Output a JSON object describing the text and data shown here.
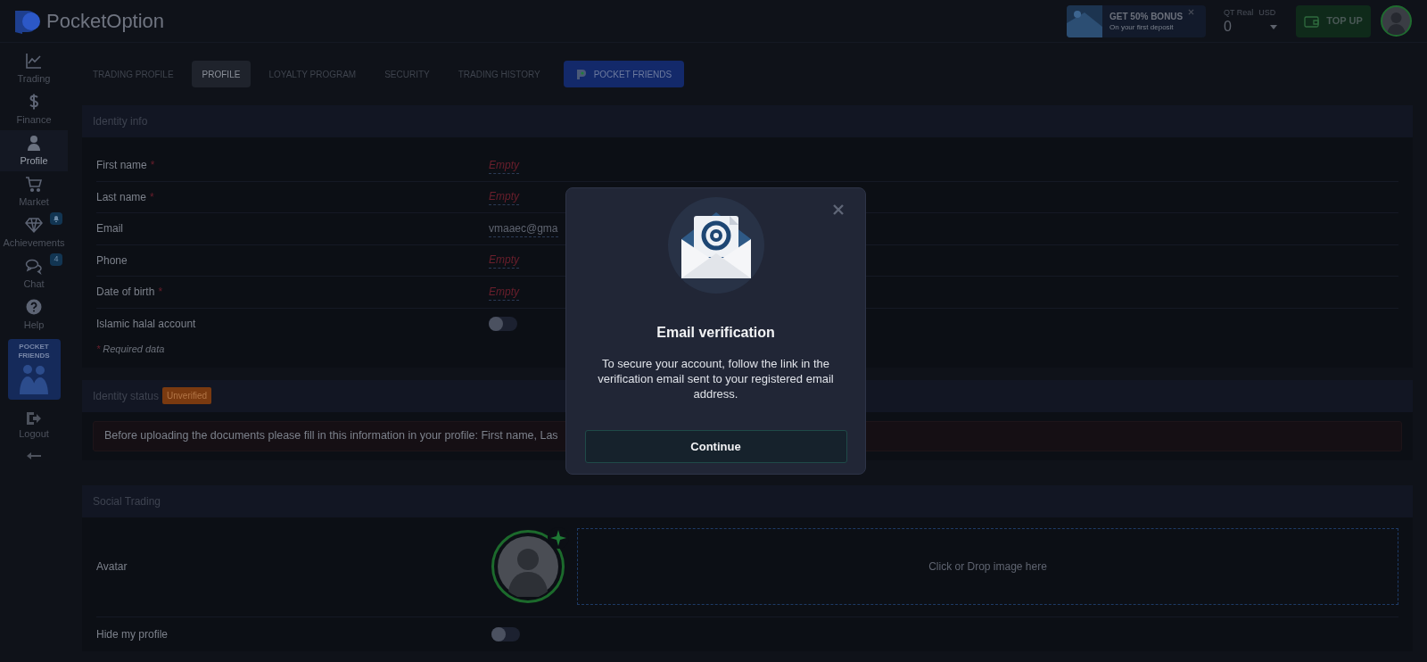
{
  "header": {
    "logo": "**Pocket**Option",
    "bonus": {
      "title": "GET 50% BONUS",
      "subtitle": "On your first deposit"
    },
    "account": {
      "label": "QT Real",
      "currency": "USD",
      "balance": "0"
    },
    "top_up": "TOP UP"
  },
  "sidebar": [
    {
      "label": "Trading",
      "selected": false,
      "kind": "plain"
    },
    {
      "label": "Finance",
      "selected": false,
      "kind": "plain"
    },
    {
      "label": "Profile",
      "selected": true,
      "kind": "plain"
    },
    {
      "label": "Market",
      "selected": false,
      "kind": "plain"
    },
    {
      "label": "Achievements",
      "selected": false,
      "kind": "bell"
    },
    {
      "label": "Chat",
      "selected": false,
      "kind": "count",
      "badge": "4"
    },
    {
      "label": "Help",
      "selected": false,
      "kind": "plain"
    }
  ],
  "promo_card": {
    "title": "POCKET FRIENDS"
  },
  "logout": "Logout",
  "tabs": [
    {
      "label": "TRADING PROFILE",
      "selected": false,
      "kind": "plain"
    },
    {
      "label": "PROFILE",
      "selected": true,
      "kind": "plain"
    },
    {
      "label": "LOYALTY PROGRAM",
      "selected": false,
      "kind": "plain"
    },
    {
      "label": "SECURITY",
      "selected": false,
      "kind": "plain"
    },
    {
      "label": "TRADING HISTORY",
      "selected": false,
      "kind": "plain"
    },
    {
      "label": "POCKET FRIENDS",
      "selected": false,
      "kind": "featured"
    }
  ],
  "identity_info": {
    "title": "Identity info",
    "required_mark": "*",
    "rows": [
      {
        "kind": "text",
        "label": "First name",
        "required": true,
        "value": "Empty",
        "empty": true
      },
      {
        "kind": "text",
        "label": "Last name",
        "required": true,
        "value": "Empty",
        "empty": true
      },
      {
        "kind": "text",
        "label": "Email",
        "required": false,
        "value": "vmaaec@gma",
        "empty": false
      },
      {
        "kind": "text",
        "label": "Phone",
        "required": false,
        "value": "Empty",
        "empty": true
      },
      {
        "kind": "text",
        "label": "Date of birth",
        "required": true,
        "value": "Empty",
        "empty": true
      },
      {
        "kind": "toggle",
        "label": "Islamic halal account",
        "required": false,
        "on": false
      }
    ],
    "required_note": "Required data"
  },
  "identity_status": {
    "title": "Identity status",
    "badge": "Unverified",
    "notice": "Before uploading the documents please fill in this information in your profile: First name, Las"
  },
  "social_trading": {
    "title": "Social Trading",
    "avatar_label": "Avatar",
    "drop_text": "Click or Drop image here",
    "hide_label": "Hide my profile",
    "hide_on": false
  },
  "modal": {
    "title": "Email verification",
    "text": "To secure your account, follow the link in the verification email sent to your registered email address.",
    "button": "Continue"
  }
}
